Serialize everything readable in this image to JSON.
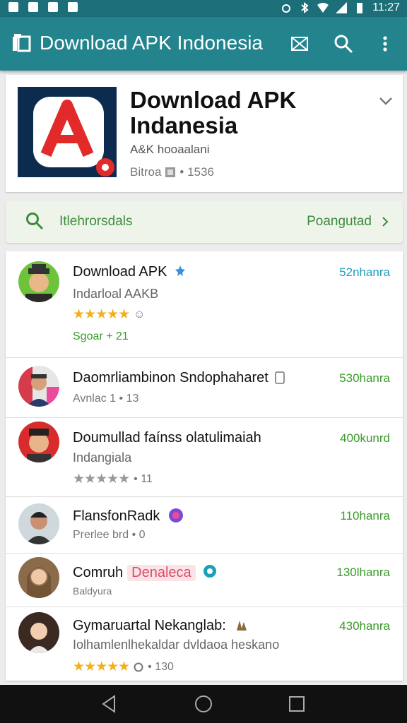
{
  "status_bar": {
    "time": "11:27"
  },
  "app_bar": {
    "title": "Download APK Indonesia"
  },
  "hero": {
    "title_line1": "Download APK",
    "title_line2": "Indanesia",
    "subtitle": "A&K hooaalani",
    "meta_prefix": "Bitroa",
    "meta_value": "• 1536"
  },
  "green_bar": {
    "label": "Itlehrorsdals",
    "action": "Poangutad"
  },
  "items": [
    {
      "name": "Download APK",
      "sub": "Indarloal AAKB",
      "meta": "Sgoar  + 21",
      "value": "52nhanra",
      "value_color": "#1aa0b8",
      "stars": "★★★★★",
      "star_grey": false
    },
    {
      "name": "Daomrliambinon Sndophaharet",
      "sub": "",
      "meta": "Avnlac 1 • 13",
      "value": "530hanra",
      "value_color": "#3a9a2a",
      "stars": "",
      "star_grey": false
    },
    {
      "name": "Doumullad faínss olatulimaiah",
      "sub": "Indangiala",
      "meta": "• 11",
      "value": "400kunrd",
      "value_color": "#3a9a2a",
      "stars": "★★★★★",
      "star_grey": true
    },
    {
      "name": "FlansfonRadk",
      "sub": "",
      "meta": "Prerlee brd • 0",
      "value": "110hanra",
      "value_color": "#3a9a2a",
      "stars": "",
      "star_grey": false
    },
    {
      "name": "Comruh",
      "pill": "Denaleca",
      "sub": "",
      "meta": "Baldyura",
      "value": "130lhanra",
      "value_color": "#3a9a2a",
      "stars": "",
      "star_grey": false
    },
    {
      "name": "Gymaruartal Nekanglab:",
      "sub": "Iolhamlenlhekaldar dvldaoa heskano",
      "meta": "• 130",
      "value": "430hanra",
      "value_color": "#3a9a2a",
      "stars": "★★★★★",
      "star_grey": false
    }
  ],
  "icons": {
    "app_logo": "app-logo-icon",
    "cast": "cast-icon",
    "search": "search-icon",
    "overflow": "more-vert-icon",
    "expand": "chevron-down-icon",
    "back": "back-triangle-icon",
    "home": "home-circle-icon",
    "recents": "recents-square-icon"
  },
  "colors": {
    "app_bar": "#23848e",
    "status_bar": "#1c6f79",
    "accent_green": "#3d8c3d"
  }
}
